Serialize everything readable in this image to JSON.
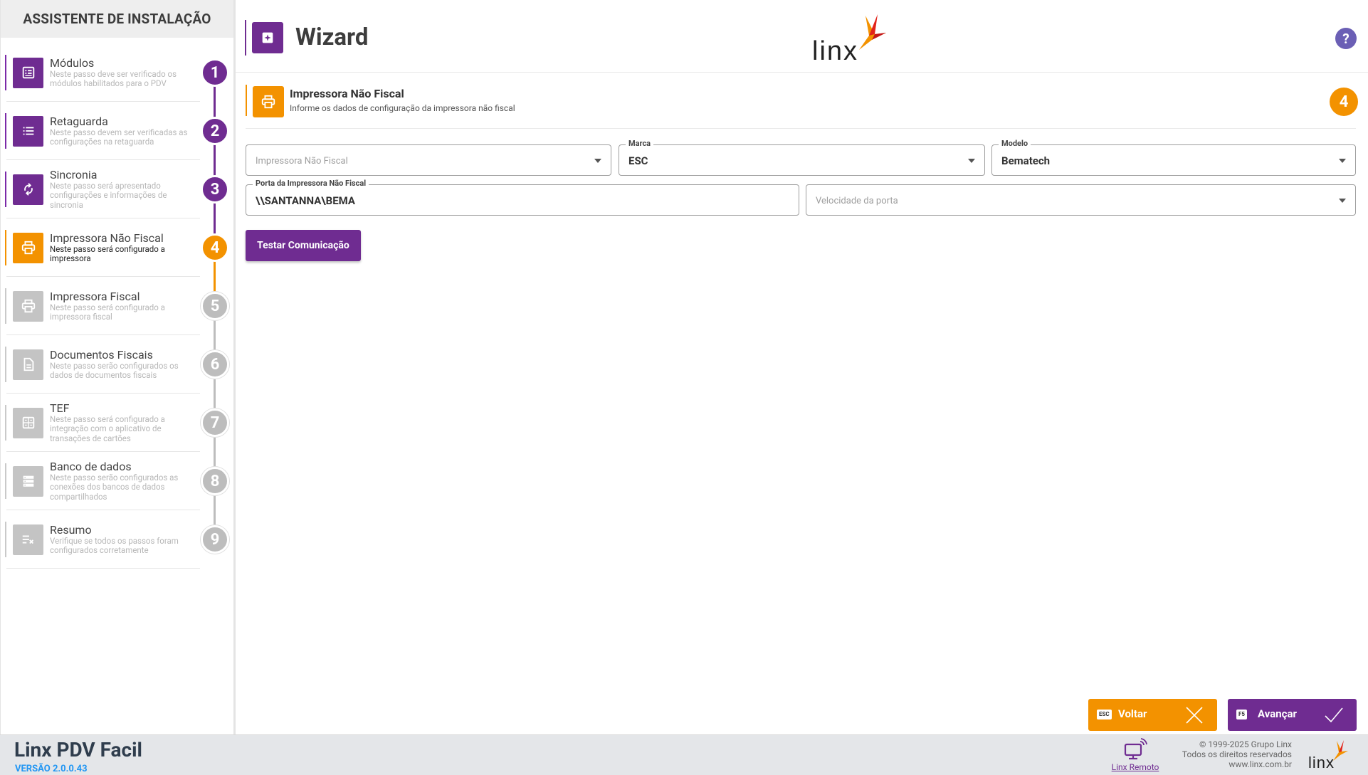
{
  "sidebar": {
    "title": "ASSISTENTE DE INSTALAÇÃO",
    "steps": [
      {
        "title": "Módulos",
        "desc": "Neste passo deve ser verificado os módulos habilitados para o PDV",
        "num": "1",
        "state": "done",
        "icon": "list-icon"
      },
      {
        "title": "Retaguarda",
        "desc": "Neste passo devem ser verificadas as configurações na retaguarda",
        "num": "2",
        "state": "done",
        "icon": "list-lines-icon"
      },
      {
        "title": "Sincronia",
        "desc": "Neste passo será apresentado configurações e informações de sincronia",
        "num": "3",
        "state": "done",
        "icon": "sync-icon"
      },
      {
        "title": "Impressora Não Fiscal",
        "desc": "Neste passo será configurado a impressora",
        "num": "4",
        "state": "active",
        "icon": "printer-icon"
      },
      {
        "title": "Impressora Fiscal",
        "desc": "Neste passo será configurado a impressora fiscal",
        "num": "5",
        "state": "pending",
        "icon": "printer-icon"
      },
      {
        "title": "Documentos Fiscais",
        "desc": "Neste passo serão configurados os dados de documentos fiscais",
        "num": "6",
        "state": "pending",
        "icon": "document-icon"
      },
      {
        "title": "TEF",
        "desc": "Neste passo será configurado a integração com o aplicativo de transações de cartões",
        "num": "7",
        "state": "pending",
        "icon": "calculator-icon"
      },
      {
        "title": "Banco de dados",
        "desc": "Neste passo serão configurados as conexões dos bancos de dados compartilhados",
        "num": "8",
        "state": "pending",
        "icon": "database-icon"
      },
      {
        "title": "Resumo",
        "desc": "Verifique se todos os passos foram configurados corretamente",
        "num": "9",
        "state": "pending",
        "icon": "checklist-icon"
      }
    ]
  },
  "header": {
    "title": "Wizard",
    "logo_text": "linx",
    "help": "?"
  },
  "section": {
    "title": "Impressora Não Fiscal",
    "desc": "Informe os dados de configuração da impressora não fiscal",
    "num": "4"
  },
  "form": {
    "impressora": {
      "placeholder": "Impressora Não Fiscal",
      "value": ""
    },
    "marca": {
      "label": "Marca",
      "value": "ESC"
    },
    "modelo": {
      "label": "Modelo",
      "value": "Bematech"
    },
    "porta": {
      "label": "Porta da Impressora Não Fiscal",
      "value": "\\\\SANTANNA\\BEMA"
    },
    "velocidade": {
      "placeholder": "Velocidade da porta",
      "value": ""
    },
    "test_button": "Testar Comunicação"
  },
  "actions": {
    "back": {
      "key": "ESC",
      "label": "Voltar"
    },
    "next": {
      "key": "F5",
      "label": "Avançar"
    }
  },
  "footer": {
    "app_name": "Linx PDV Facil",
    "version": "VERSÃO 2.0.0.43",
    "remote_label": "Linx Remoto",
    "copyright": "© 1999-2025 Grupo Linx",
    "rights": "Todos os direitos reservados",
    "site": "www.linx.com.br",
    "logo_text": "linx"
  },
  "colors": {
    "purple": "#6f2c91",
    "orange": "#f39200",
    "gray": "#c4c4c4"
  }
}
